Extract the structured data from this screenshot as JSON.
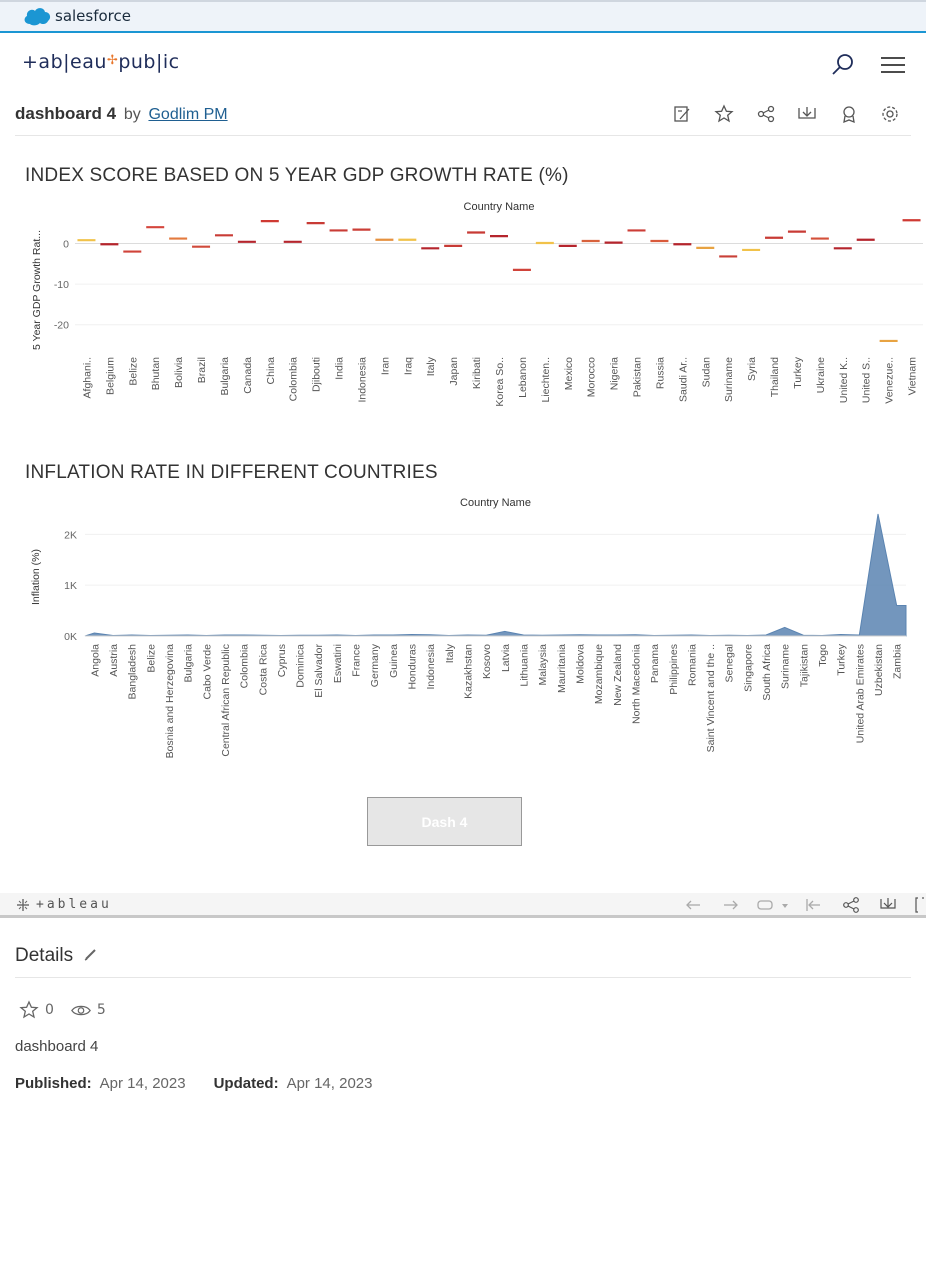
{
  "salesforce": {
    "brand": "salesforce"
  },
  "tableau_public": {
    "logo_left": "+ab|eau",
    "logo_right": "pub|ic"
  },
  "viz": {
    "title": "dashboard 4",
    "by": "by",
    "author": "Godlim PM"
  },
  "toolbar_icons": [
    "edit-icon",
    "star-icon",
    "share-icon",
    "download-icon",
    "badge-icon",
    "settings-icon"
  ],
  "chart_data": [
    {
      "type": "scatter",
      "title": "INDEX SCORE BASED ON 5 YEAR GDP GROWTH RATE (%)",
      "xlabel": "Country Name",
      "ylabel": "5 Year GDP Growth Rat...",
      "yticks": [
        "0",
        "-10",
        "-20"
      ],
      "ylim": [
        -25,
        7
      ],
      "mark": "horizontal dash",
      "categories": [
        "Afghani..",
        "Belgium",
        "Belize",
        "Bhutan",
        "Bolivia",
        "Brazil",
        "Bulgaria",
        "Canada",
        "China",
        "Colombia",
        "Djibouti",
        "India",
        "Indonesia",
        "Iran",
        "Iraq",
        "Italy",
        "Japan",
        "Kiribati",
        "Korea So..",
        "Lebanon",
        "Liechten..",
        "Mexico",
        "Morocco",
        "Nigeria",
        "Pakistan",
        "Russia",
        "Saudi Ar..",
        "Sudan",
        "Suriname",
        "Syria",
        "Thailand",
        "Turkey",
        "Ukraine",
        "United K..",
        "United S..",
        "Venezue..",
        "Vietnam"
      ],
      "values": [
        0.8,
        -0.2,
        -2.0,
        4.0,
        1.2,
        -0.8,
        2.0,
        0.4,
        5.5,
        0.4,
        5.0,
        3.2,
        3.4,
        0.9,
        0.9,
        -1.2,
        -0.6,
        2.7,
        1.8,
        -6.5,
        0.1,
        -0.6,
        0.6,
        0.2,
        3.2,
        0.6,
        -0.2,
        -1.1,
        -3.2,
        -1.6,
        1.4,
        2.9,
        1.2,
        -1.2,
        0.9,
        -24.0,
        5.7
      ],
      "colors": [
        "#f1c24a",
        "#b5252d",
        "#d0433a",
        "#d4463d",
        "#e37a3e",
        "#d04a3b",
        "#c93c36",
        "#b5252d",
        "#cf3a33",
        "#b5252d",
        "#c83b35",
        "#c93c36",
        "#cb3f37",
        "#e6913f",
        "#f1c24a",
        "#b5252d",
        "#c73a35",
        "#c83a35",
        "#b5252d",
        "#d0433a",
        "#f1c24a",
        "#b5252d",
        "#d8623c",
        "#b5252d",
        "#cc3e37",
        "#d95a3b",
        "#b5252d",
        "#e8a342",
        "#c94038",
        "#f1c24a",
        "#c83b35",
        "#c83b35",
        "#d4503a",
        "#b5252d",
        "#b5252d",
        "#e8a342",
        "#cf3a33"
      ]
    },
    {
      "type": "area",
      "title": "INFLATION RATE IN DIFFERENT COUNTRIES",
      "xlabel": "Country Name",
      "ylabel": "Inflation (%)",
      "yticks": [
        "2K",
        "1K",
        "0K"
      ],
      "ylim": [
        0,
        2400
      ],
      "color": "#5b84b1",
      "categories": [
        "Angola",
        "Austria",
        "Bangladesh",
        "Belize",
        "Bosnia and Herzegovina",
        "Bulgaria",
        "Cabo Verde",
        "Central African Republic",
        "Colombia",
        "Costa Rica",
        "Cyprus",
        "Dominica",
        "El Salvador",
        "Eswatini",
        "France",
        "Germany",
        "Guinea",
        "Honduras",
        "Indonesia",
        "Italy",
        "Kazakhstan",
        "Kosovo",
        "Latvia",
        "Lithuania",
        "Malaysia",
        "Mauritania",
        "Moldova",
        "Mozambique",
        "New Zealand",
        "North Macedonia",
        "Panama",
        "Philippines",
        "Romania",
        "Saint Vincent and the ..",
        "Senegal",
        "Singapore",
        "South Africa",
        "Suriname",
        "Tajikistan",
        "Togo",
        "Turkey",
        "United Arab Emirates",
        "Uzbekistan",
        "Zambia"
      ],
      "values": [
        60,
        10,
        20,
        10,
        15,
        20,
        10,
        20,
        20,
        15,
        10,
        15,
        15,
        20,
        10,
        20,
        20,
        30,
        25,
        10,
        20,
        15,
        90,
        20,
        15,
        20,
        25,
        20,
        20,
        25,
        10,
        15,
        20,
        10,
        15,
        10,
        20,
        170,
        15,
        10,
        30,
        20,
        2400,
        600
      ]
    }
  ],
  "dash_button": {
    "label": "Dash 4"
  },
  "tableau_toolbar": {
    "brand": "+ableau"
  },
  "details": {
    "heading": "Details",
    "favorites": "0",
    "views": "5",
    "description": "dashboard 4",
    "published_label": "Published:",
    "published_value": "Apr 14, 2023",
    "updated_label": "Updated:",
    "updated_value": "Apr 14, 2023"
  }
}
